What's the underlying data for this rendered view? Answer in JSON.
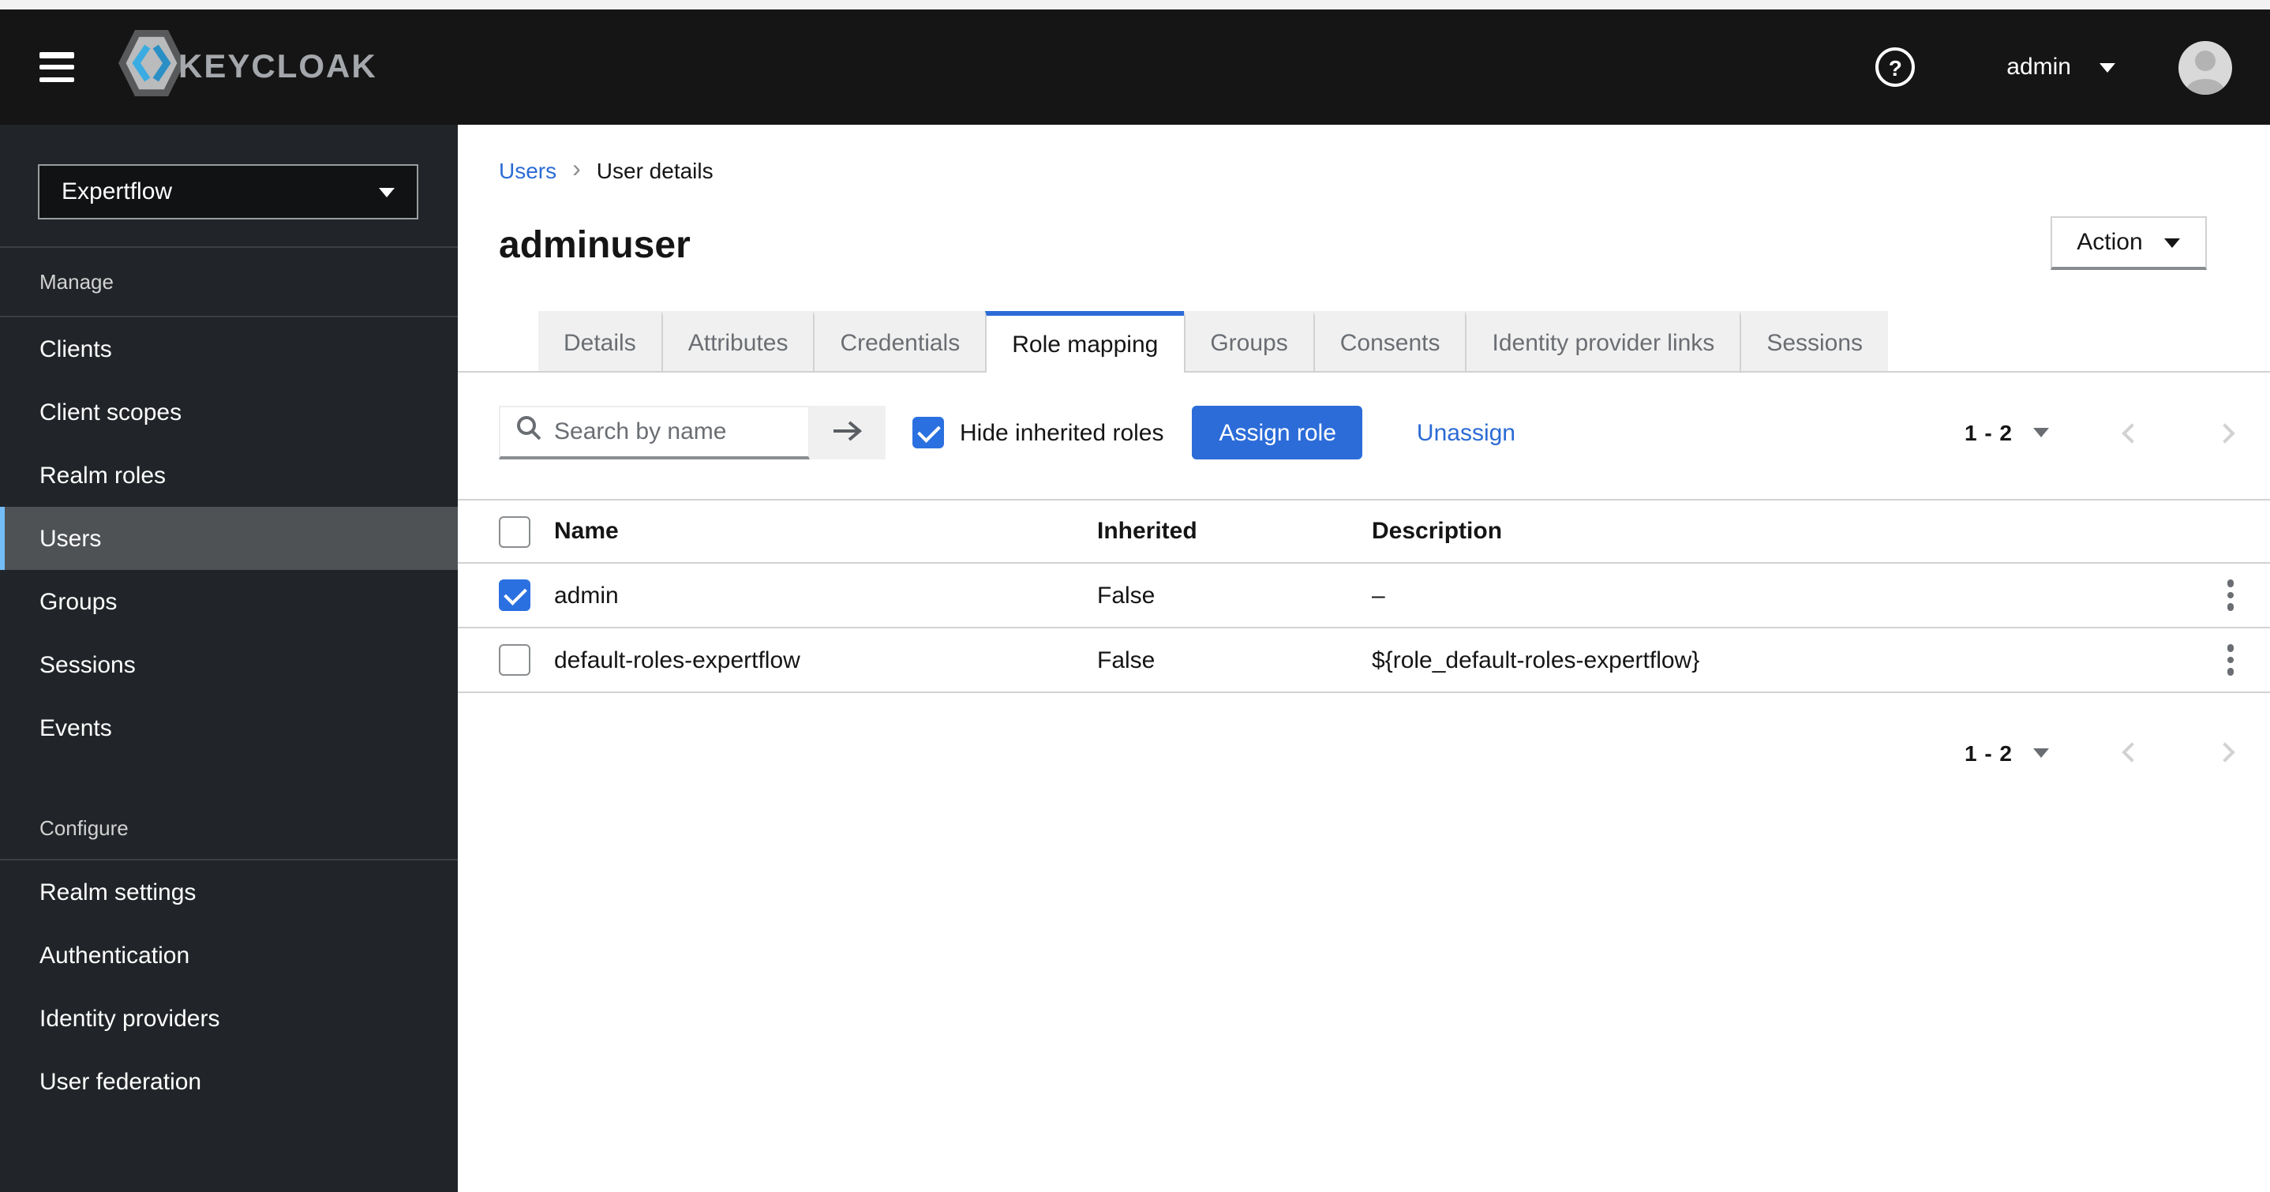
{
  "masthead": {
    "brand": "KEYCLOAK",
    "help_glyph": "?",
    "user": {
      "name": "admin"
    }
  },
  "sidebar": {
    "realm_selector": {
      "value": "Expertflow"
    },
    "sections": [
      {
        "label": "Manage",
        "items": [
          {
            "label": "Clients",
            "active": false
          },
          {
            "label": "Client scopes",
            "active": false
          },
          {
            "label": "Realm roles",
            "active": false
          },
          {
            "label": "Users",
            "active": true
          },
          {
            "label": "Groups",
            "active": false
          },
          {
            "label": "Sessions",
            "active": false
          },
          {
            "label": "Events",
            "active": false
          }
        ]
      },
      {
        "label": "Configure",
        "items": [
          {
            "label": "Realm settings",
            "active": false
          },
          {
            "label": "Authentication",
            "active": false
          },
          {
            "label": "Identity providers",
            "active": false
          },
          {
            "label": "User federation",
            "active": false
          }
        ]
      }
    ]
  },
  "breadcrumb": {
    "items": [
      {
        "label": "Users",
        "type": "link"
      },
      {
        "label": "User details",
        "type": "current"
      }
    ]
  },
  "page": {
    "title": "adminuser",
    "action_label": "Action"
  },
  "tabs": [
    {
      "label": "Details",
      "active": false
    },
    {
      "label": "Attributes",
      "active": false
    },
    {
      "label": "Credentials",
      "active": false
    },
    {
      "label": "Role mapping",
      "active": true
    },
    {
      "label": "Groups",
      "active": false
    },
    {
      "label": "Consents",
      "active": false
    },
    {
      "label": "Identity provider links",
      "active": false
    },
    {
      "label": "Sessions",
      "active": false
    }
  ],
  "toolbar": {
    "search": {
      "placeholder": "Search by name",
      "value": ""
    },
    "hide_inherited": {
      "label": "Hide inherited roles",
      "checked": true
    },
    "assign_label": "Assign role",
    "unassign_label": "Unassign",
    "pagination": {
      "range": "1 - 2"
    }
  },
  "table": {
    "columns": [
      "Name",
      "Inherited",
      "Description"
    ],
    "rows": [
      {
        "selected": true,
        "name": "admin",
        "inherited": "False",
        "description": "–"
      },
      {
        "selected": false,
        "name": "default-roles-expertflow",
        "inherited": "False",
        "description": "${role_default-roles-expertflow}"
      }
    ]
  },
  "pagination_bottom": {
    "range": "1 - 2"
  },
  "colors": {
    "masthead_bg": "#151515",
    "sidebar_bg": "#212428",
    "sidebar_active_bg": "#4f5255",
    "sidebar_accent": "#73bcf7",
    "primary_blue": "#2b6cd8",
    "checkbox_blue": "#2b70e0",
    "link_blue": "#2b6bd4",
    "tab_inactive_bg": "#f0f0f0",
    "border_gray": "#d2d2d2",
    "text_secondary": "#6a6e73"
  }
}
